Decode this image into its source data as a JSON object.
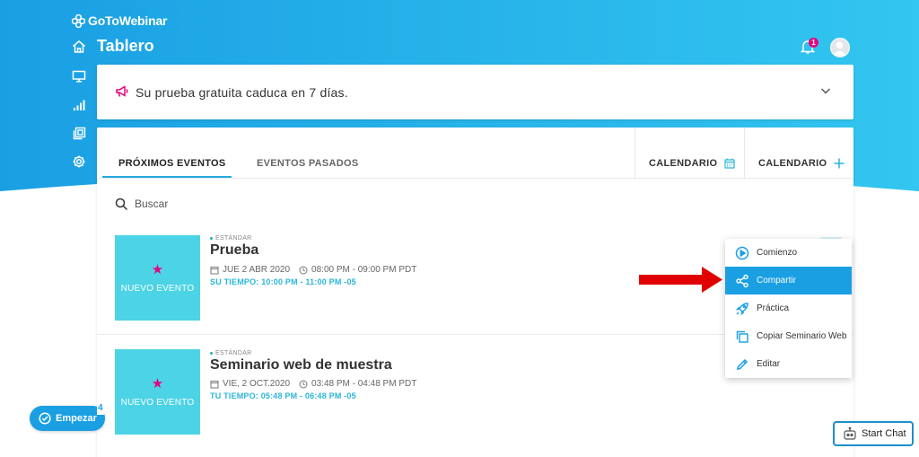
{
  "header": {
    "logo": "GoToWebinar",
    "page_title": "Tablero",
    "notification_count": "1"
  },
  "colors": {
    "hero_gradient": [
      "#1a9fe3",
      "#33c6f0"
    ],
    "accent": "#1a9fe3",
    "pink": "#e5007e",
    "event_thumb": "#4cd3e6",
    "alert_arrow": "#e00000"
  },
  "sidebar": {
    "items": [
      {
        "icon": "home-icon"
      },
      {
        "icon": "monitor-icon"
      },
      {
        "icon": "bar-chart-icon"
      },
      {
        "icon": "recordings-icon"
      },
      {
        "icon": "gear-icon"
      }
    ]
  },
  "trial": {
    "icon": "megaphone-icon",
    "text": "Su prueba gratuita caduca en 7 días."
  },
  "tabs": {
    "upcoming": "PRÓXIMOS EVENTOS",
    "past": "EVENTOS PASADOS",
    "calendar": "CALENDARIO",
    "calendar_add": "CALENDARIO"
  },
  "search": {
    "placeholder": "Buscar",
    "value": ""
  },
  "events": [
    {
      "thumb_label": "NUEVO EVENTO",
      "type": "ESTÁNDAR",
      "title": "Prueba",
      "date": "JUE 2 ABR 2020",
      "time": "08:00 PM - 09:00 PM PDT",
      "local_time": "SU TIEMPO: 10:00 PM - 11:00 PM -05"
    },
    {
      "thumb_label": "NUEVO EVENTO",
      "type": "ESTÁNDAR",
      "title": "Seminario web de muestra",
      "date": "VIE, 2 OCT.2020",
      "time": "03:48 PM - 04:48 PM PDT",
      "local_time": "TU TIEMPO: 05:48 PM - 06:48 PM -05"
    }
  ],
  "context_menu": {
    "items": [
      {
        "label": "Comienzo",
        "icon": "play-circle-icon"
      },
      {
        "label": "Compartir",
        "icon": "share-icon",
        "selected": true
      },
      {
        "label": "Práctica",
        "icon": "rocket-icon"
      },
      {
        "label": "Copiar Seminario Web",
        "icon": "copy-icon"
      },
      {
        "label": "Editar",
        "icon": "pencil-icon"
      }
    ]
  },
  "onboarding": {
    "label": "Empezar",
    "count": "4"
  },
  "chat": {
    "label": "Start Chat"
  }
}
